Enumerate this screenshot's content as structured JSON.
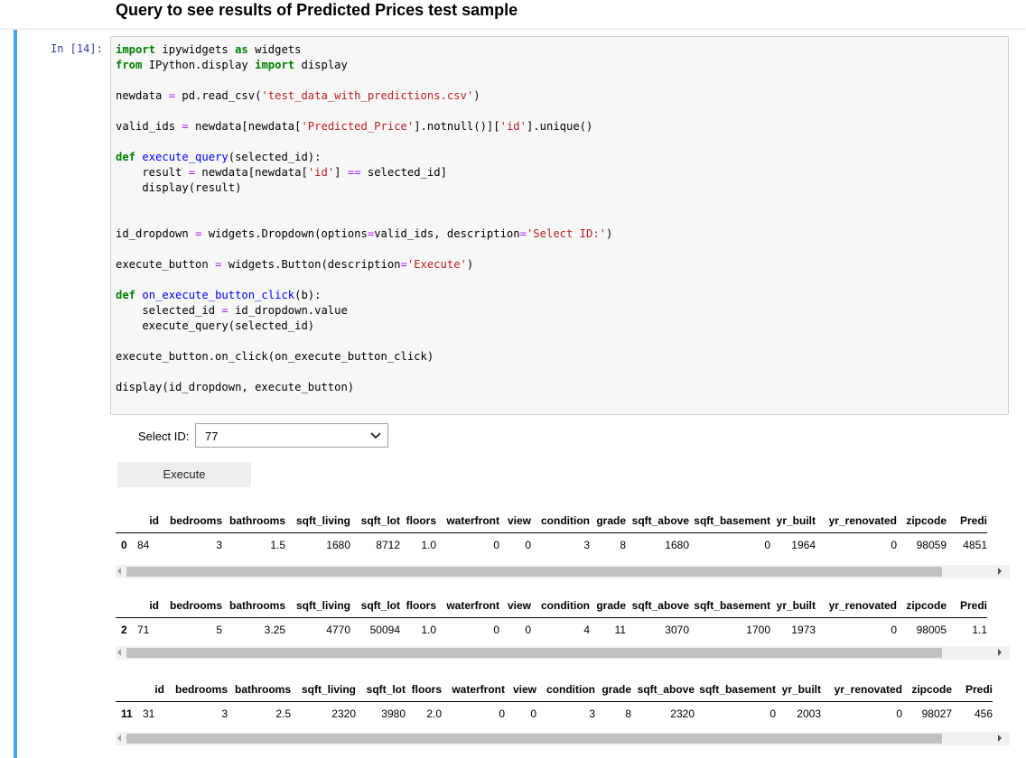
{
  "heading": "Query to see results of Predicted Prices test sample",
  "prompt": "In [14]:",
  "widgets": {
    "select_label": "Select ID:",
    "select_value": "77",
    "execute_label": "Execute"
  },
  "columns": [
    "",
    "id",
    "bedrooms",
    "bathrooms",
    "sqft_living",
    "sqft_lot",
    "floors",
    "waterfront",
    "view",
    "condition",
    "grade",
    "sqft_above",
    "sqft_basement",
    "yr_built",
    "yr_renovated",
    "zipcode",
    "Predi"
  ],
  "results": [
    {
      "index": "0",
      "row": [
        "84",
        "3",
        "1.5",
        "1680",
        "8712",
        "1.0",
        "0",
        "0",
        "3",
        "8",
        "1680",
        "0",
        "1964",
        "0",
        "98059",
        "4851"
      ]
    },
    {
      "index": "2",
      "row": [
        "71",
        "5",
        "3.25",
        "4770",
        "50094",
        "1.0",
        "0",
        "0",
        "4",
        "11",
        "3070",
        "1700",
        "1973",
        "0",
        "98005",
        "1.1"
      ]
    },
    {
      "index": "11",
      "row": [
        "31",
        "3",
        "2.5",
        "2320",
        "3980",
        "2.0",
        "0",
        "0",
        "3",
        "8",
        "2320",
        "0",
        "2003",
        "0",
        "98027",
        "456"
      ]
    }
  ]
}
